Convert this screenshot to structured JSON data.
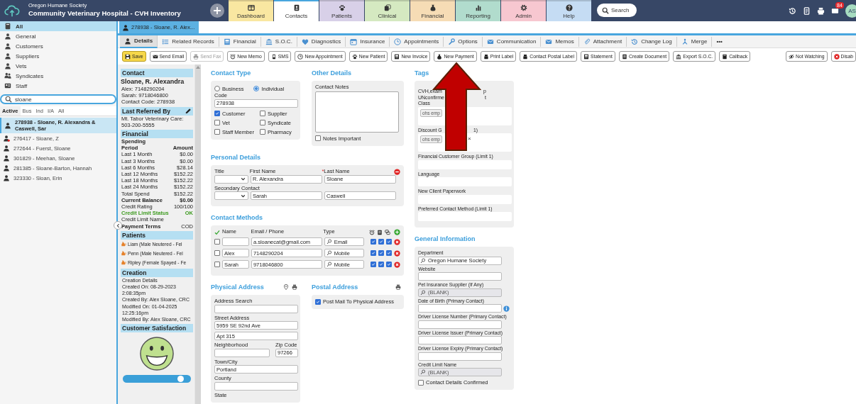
{
  "header": {
    "org": "Oregon Humane Society",
    "title": "Community Veterinary Hospital - CVH Inventory",
    "search": "Search",
    "mail_count": "84",
    "avatar": "AS"
  },
  "nav_tabs": [
    {
      "label": "Dashboard",
      "kind": "panel",
      "color": "#f9e7a1",
      "selected": false
    },
    {
      "label": "Contacts",
      "kind": "card",
      "color": "#ffffff",
      "selected": true
    },
    {
      "label": "Patients",
      "kind": "paw",
      "color": "#d8d0e8",
      "selected": false
    },
    {
      "label": "Clinical",
      "kind": "stack",
      "color": "#d5e9c1",
      "selected": false
    },
    {
      "label": "Financial",
      "kind": "moneybag",
      "color": "#f6dcb5",
      "selected": false
    },
    {
      "label": "Reporting",
      "kind": "bars",
      "color": "#b1dccd",
      "selected": false
    },
    {
      "label": "Admin",
      "kind": "gear",
      "color": "#f7c7d0",
      "selected": false
    },
    {
      "label": "Help",
      "kind": "help",
      "color": "#c5dcf3",
      "selected": false
    }
  ],
  "sidebar": {
    "categories": [
      {
        "label": "All",
        "kind": "book",
        "selected": true
      },
      {
        "label": "General",
        "kind": "person",
        "selected": false
      },
      {
        "label": "Customers",
        "kind": "person",
        "selected": false
      },
      {
        "label": "Suppliers",
        "kind": "person",
        "selected": false
      },
      {
        "label": "Vets",
        "kind": "person",
        "selected": false
      },
      {
        "label": "Syndicates",
        "kind": "people",
        "selected": false
      },
      {
        "label": "Staff",
        "kind": "idcard",
        "selected": false
      }
    ],
    "search": {
      "value": "sloane"
    },
    "filters": [
      {
        "label": "Active",
        "selected": true
      },
      {
        "label": "Bus",
        "selected": false
      },
      {
        "label": "Ind",
        "selected": false
      },
      {
        "label": "I/A",
        "selected": false
      },
      {
        "label": "All",
        "selected": false
      }
    ],
    "results": [
      {
        "label": "278938 - Sloane, R. Alexandra & Caswell, Sar",
        "kind": "person",
        "selected": true
      },
      {
        "label": "276417 - Sloane, Z",
        "kind": "flagged",
        "selected": false
      },
      {
        "label": "272644 - Fuerst, Sloane",
        "kind": "person",
        "selected": false
      },
      {
        "label": "301829 - Meehan, Sloane",
        "kind": "person",
        "selected": false
      },
      {
        "label": "281385 - Sloane-Barton, Hannah",
        "kind": "person",
        "selected": false
      },
      {
        "label": "323330 - Sloan, Erin",
        "kind": "person",
        "selected": false
      }
    ]
  },
  "record_tab": "278938 - Sloane, R. Alex...",
  "sub_tabs": [
    {
      "label": "Details",
      "kind": "person",
      "selected": true
    },
    {
      "label": "Related Records",
      "kind": "list",
      "selected": false
    },
    {
      "label": "Financial",
      "kind": "invoice",
      "selected": false
    },
    {
      "label": "S.O.C.",
      "kind": "bank",
      "selected": false
    },
    {
      "label": "Diagnostics",
      "kind": "heart",
      "selected": false
    },
    {
      "label": "Insurance",
      "kind": "calendar",
      "selected": false
    },
    {
      "label": "Appointments",
      "kind": "clock",
      "selected": false
    },
    {
      "label": "Options",
      "kind": "wrench",
      "selected": false
    },
    {
      "label": "Communication",
      "kind": "mail",
      "selected": false
    },
    {
      "label": "Memos",
      "kind": "mail",
      "selected": false
    },
    {
      "label": "Attachment",
      "kind": "clip",
      "selected": false
    },
    {
      "label": "Change Log",
      "kind": "history",
      "selected": false
    },
    {
      "label": "Merge",
      "kind": "merge",
      "selected": false
    },
    {
      "label": "•••",
      "kind": "more",
      "selected": false
    }
  ],
  "toolbar_left": [
    {
      "label": "Save",
      "kind": "floppy",
      "disabled": false
    },
    {
      "label": "Send Email",
      "kind": "mail",
      "disabled": false
    },
    {
      "label": "Send Fax",
      "kind": "print",
      "disabled": true
    },
    {
      "label": "New Memo",
      "kind": "alarm",
      "disabled": false
    },
    {
      "label": "SMS",
      "kind": "phone",
      "disabled": false
    },
    {
      "label": "New Appointment",
      "kind": "clock",
      "disabled": false
    },
    {
      "label": "New Patient",
      "kind": "paw",
      "disabled": false
    },
    {
      "label": "New Invoice",
      "kind": "invoice",
      "disabled": false
    },
    {
      "label": "New Payment",
      "kind": "moneybag",
      "disabled": false
    },
    {
      "label": "Print Label",
      "kind": "label",
      "disabled": false
    },
    {
      "label": "Contact Postal Label",
      "kind": "label",
      "disabled": false
    },
    {
      "label": "Statement",
      "kind": "invoice",
      "disabled": false
    },
    {
      "label": "Create Document",
      "kind": "doc",
      "disabled": false
    },
    {
      "label": "Export S.O.C.",
      "kind": "bank",
      "disabled": false
    },
    {
      "label": "Callback",
      "kind": "book",
      "disabled": false
    }
  ],
  "toolbar_right": [
    {
      "label": "Not Watching",
      "kind": "eyeoff",
      "disabled": false
    },
    {
      "label": "Disab",
      "kind": "xcircle",
      "disabled": false
    }
  ],
  "summary": {
    "contact": {
      "title": "Contact",
      "name": "Sloane, R. Alexandra",
      "lines": [
        "Alex: 7148290204",
        "Sarah: 9718046800",
        "Contact Code: 278938"
      ]
    },
    "referred": {
      "title": "Last Referred By",
      "text": "Mt. Tabor Veterinary Care: 503-200-5555"
    },
    "financial": {
      "title": "Financial",
      "subtitle": "Spending",
      "rows": [
        {
          "kind": "columns",
          "label": "Period",
          "value": "Amount"
        },
        {
          "kind": "row",
          "label": "Last 1 Month",
          "value": "$0.00"
        },
        {
          "kind": "row",
          "label": "Last 3 Months",
          "value": "$0.00"
        },
        {
          "kind": "row",
          "label": "Last 6 Months",
          "value": "$28.14"
        },
        {
          "kind": "row",
          "label": "Last 12 Months",
          "value": "$152.22"
        },
        {
          "kind": "row",
          "label": "Last 18 Months",
          "value": "$152.22"
        },
        {
          "kind": "row",
          "label": "Last 24 Months",
          "value": "$152.22"
        },
        {
          "kind": "row",
          "label": "Total Spend",
          "value": "$152.22"
        },
        {
          "kind": "total",
          "label": "Current Balance",
          "value": "$0.00"
        },
        {
          "kind": "row",
          "label": "Credit Rating",
          "value": "100/100"
        },
        {
          "kind": "status",
          "label": "Credit Limit Status",
          "value": "OK"
        },
        {
          "kind": "row",
          "label": "Credit Limit Name"
        },
        {
          "kind": "term",
          "label": "Payment Terms",
          "value": "COD"
        }
      ]
    },
    "patients": {
      "title": "Patients",
      "items": [
        "Liam (Male Neutered - Fel",
        "Penn (Male Neutered - Fel",
        "Ripley (Female Spayed - Fe"
      ]
    },
    "creation": {
      "title": "Creation",
      "lines": [
        "Creation Details",
        "Created On: 08-29-2023 2:08:35pm",
        "Created By: Alex Sloane, CRC",
        "Modified On: 01-04-2025 12:25:16pm",
        "Modified By: Alex Sloane, CRC"
      ]
    },
    "satisfaction": {
      "title": "Customer Satisfaction",
      "level": 0.9
    }
  },
  "contact_type": {
    "title": "Contact Type",
    "radios": [
      {
        "label": "Business",
        "selected": false
      },
      {
        "label": "Individual",
        "selected": true
      }
    ],
    "code_label": "Code",
    "code": "278938",
    "checkboxes": [
      {
        "label": "Customer",
        "checked": true
      },
      {
        "label": "Supplier",
        "checked": false
      },
      {
        "label": "Vet",
        "checked": false
      },
      {
        "label": "Syndicate",
        "checked": false
      },
      {
        "label": "Staff Member",
        "checked": false
      },
      {
        "label": "Pharmacy",
        "checked": false
      }
    ]
  },
  "other_details": {
    "title": "Other Details",
    "notes_label": "Contact Notes",
    "important": {
      "label": "Notes Important",
      "checked": false
    }
  },
  "personal": {
    "title": "Personal Details",
    "columns": [
      {
        "label": "Title"
      },
      {
        "label": "First Name"
      },
      {
        "label": "Last Name",
        "mark": "*"
      }
    ],
    "secondary_label": "Secondary Contact",
    "rows": [
      {
        "first": "R. Alexandra",
        "last": "Sloane"
      },
      {
        "first": "Sarah",
        "last": "Caswell"
      }
    ]
  },
  "contact_methods": {
    "title": "Contact Methods",
    "columns": [
      "Name",
      "Email / Phone",
      "Type"
    ],
    "rows": [
      {
        "selected": false,
        "value": "a.sloanecat@gmail.com",
        "type": "Email",
        "flags": [
          true,
          true,
          true
        ]
      },
      {
        "selected": false,
        "name": "Alex",
        "value": "7148290204",
        "type": "Mobile",
        "flags": [
          true,
          true,
          true
        ]
      },
      {
        "selected": false,
        "name": "Sarah",
        "value": "9718046800",
        "type": "Mobile",
        "flags": [
          true,
          true,
          true
        ]
      }
    ]
  },
  "physical": {
    "title": "Physical Address",
    "fields": [
      {
        "kind": "field",
        "label": "Address Search"
      },
      {
        "kind": "field",
        "label": "Street Address",
        "value": "5959 SE 92nd Ave"
      },
      {
        "kind": "field",
        "value": "Apt 315"
      },
      {
        "kind": "pair",
        "items": [
          {
            "label": "Neighborhood"
          },
          {
            "label": "Zip Code",
            "value": "97266"
          }
        ]
      },
      {
        "kind": "field",
        "label": "Town/City",
        "value": "Portland"
      },
      {
        "kind": "field",
        "label": "County"
      },
      {
        "kind": "label",
        "label": "State"
      }
    ]
  },
  "postal": {
    "title": "Postal Address",
    "post_mail": {
      "label": "Post Mail To Physical Address",
      "checked": true
    }
  },
  "tags": {
    "title": "Tags",
    "lines": [
      {
        "left": "CVH,exam",
        "right": "p"
      },
      {
        "left": "UNconfirme",
        "right": "t"
      }
    ],
    "groups": [
      {
        "label": "Class",
        "chips": [
          {
            "label": "ohs emp"
          }
        ]
      },
      {
        "label": "Discount G",
        "label_tail": "1)",
        "chips": [
          {
            "label": "ohs emp",
            "remove": "×"
          }
        ]
      },
      {
        "label": "Financial Customer Group (Limit 1)"
      },
      {
        "label": "Language"
      },
      {
        "label": "New Client Paperwork"
      },
      {
        "label": "Preferred Contact Method (Limit 1)"
      }
    ]
  },
  "general": {
    "title": "General Information",
    "fields": [
      {
        "kind": "lookup",
        "label": "Department",
        "value": "Oregon Humane Society",
        "disabled": false
      },
      {
        "kind": "text",
        "label": "Website"
      },
      {
        "kind": "lookup",
        "label": "Pet Insurance Supplier (If Any)",
        "value": "(BLANK)",
        "disabled": true
      },
      {
        "kind": "date",
        "label": "Date of Birth (Primary Contact)"
      },
      {
        "kind": "text",
        "label": "Driver License Number (Primary Contact)"
      },
      {
        "kind": "text",
        "label": "Driver License Issuer (Primary Contact)"
      },
      {
        "kind": "text",
        "label": "Driver License Expiry (Primary Contact)"
      },
      {
        "kind": "lookup",
        "label": "Credit Limit Name",
        "value": "(BLANK)",
        "disabled": true
      },
      {
        "kind": "checkbox",
        "label": "Contact Details Confirmed",
        "checked": false
      }
    ]
  }
}
